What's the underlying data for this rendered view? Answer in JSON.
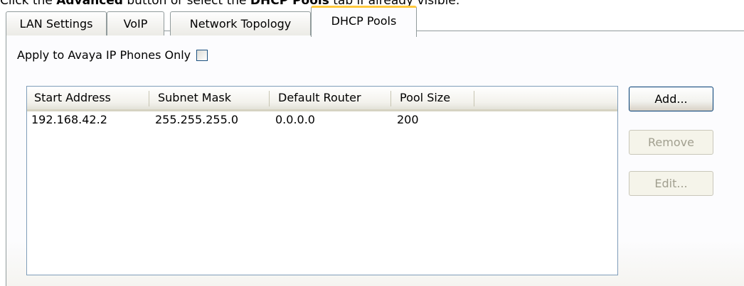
{
  "instruction": {
    "prefix": "Click the ",
    "button_name": "Advanced",
    "middle": " button or select the ",
    "tab_name": "DHCP Pools",
    "suffix": " tab if already visible."
  },
  "tabs": [
    {
      "label": "LAN Settings",
      "active": false
    },
    {
      "label": "VoIP",
      "active": false
    },
    {
      "label": "Network Topology",
      "active": false
    },
    {
      "label": "DHCP Pools",
      "active": true
    }
  ],
  "apply_option": {
    "label": "Apply to Avaya IP Phones Only",
    "checked": false
  },
  "pool_list": {
    "columns": [
      "Start Address",
      "Subnet Mask",
      "Default Router",
      "Pool Size"
    ],
    "rows": [
      [
        "192.168.42.2",
        "255.255.255.0",
        "0.0.0.0",
        "200"
      ]
    ]
  },
  "buttons": {
    "add": {
      "label": "Add...",
      "enabled": true
    },
    "remove": {
      "label": "Remove",
      "enabled": false
    },
    "edit": {
      "label": "Edit...",
      "enabled": false
    }
  },
  "colors": {
    "active_tab_accent": "#ffc83c",
    "border": "#919b9c",
    "list_border": "#7f9db9",
    "disabled_text": "#a19f8f"
  }
}
